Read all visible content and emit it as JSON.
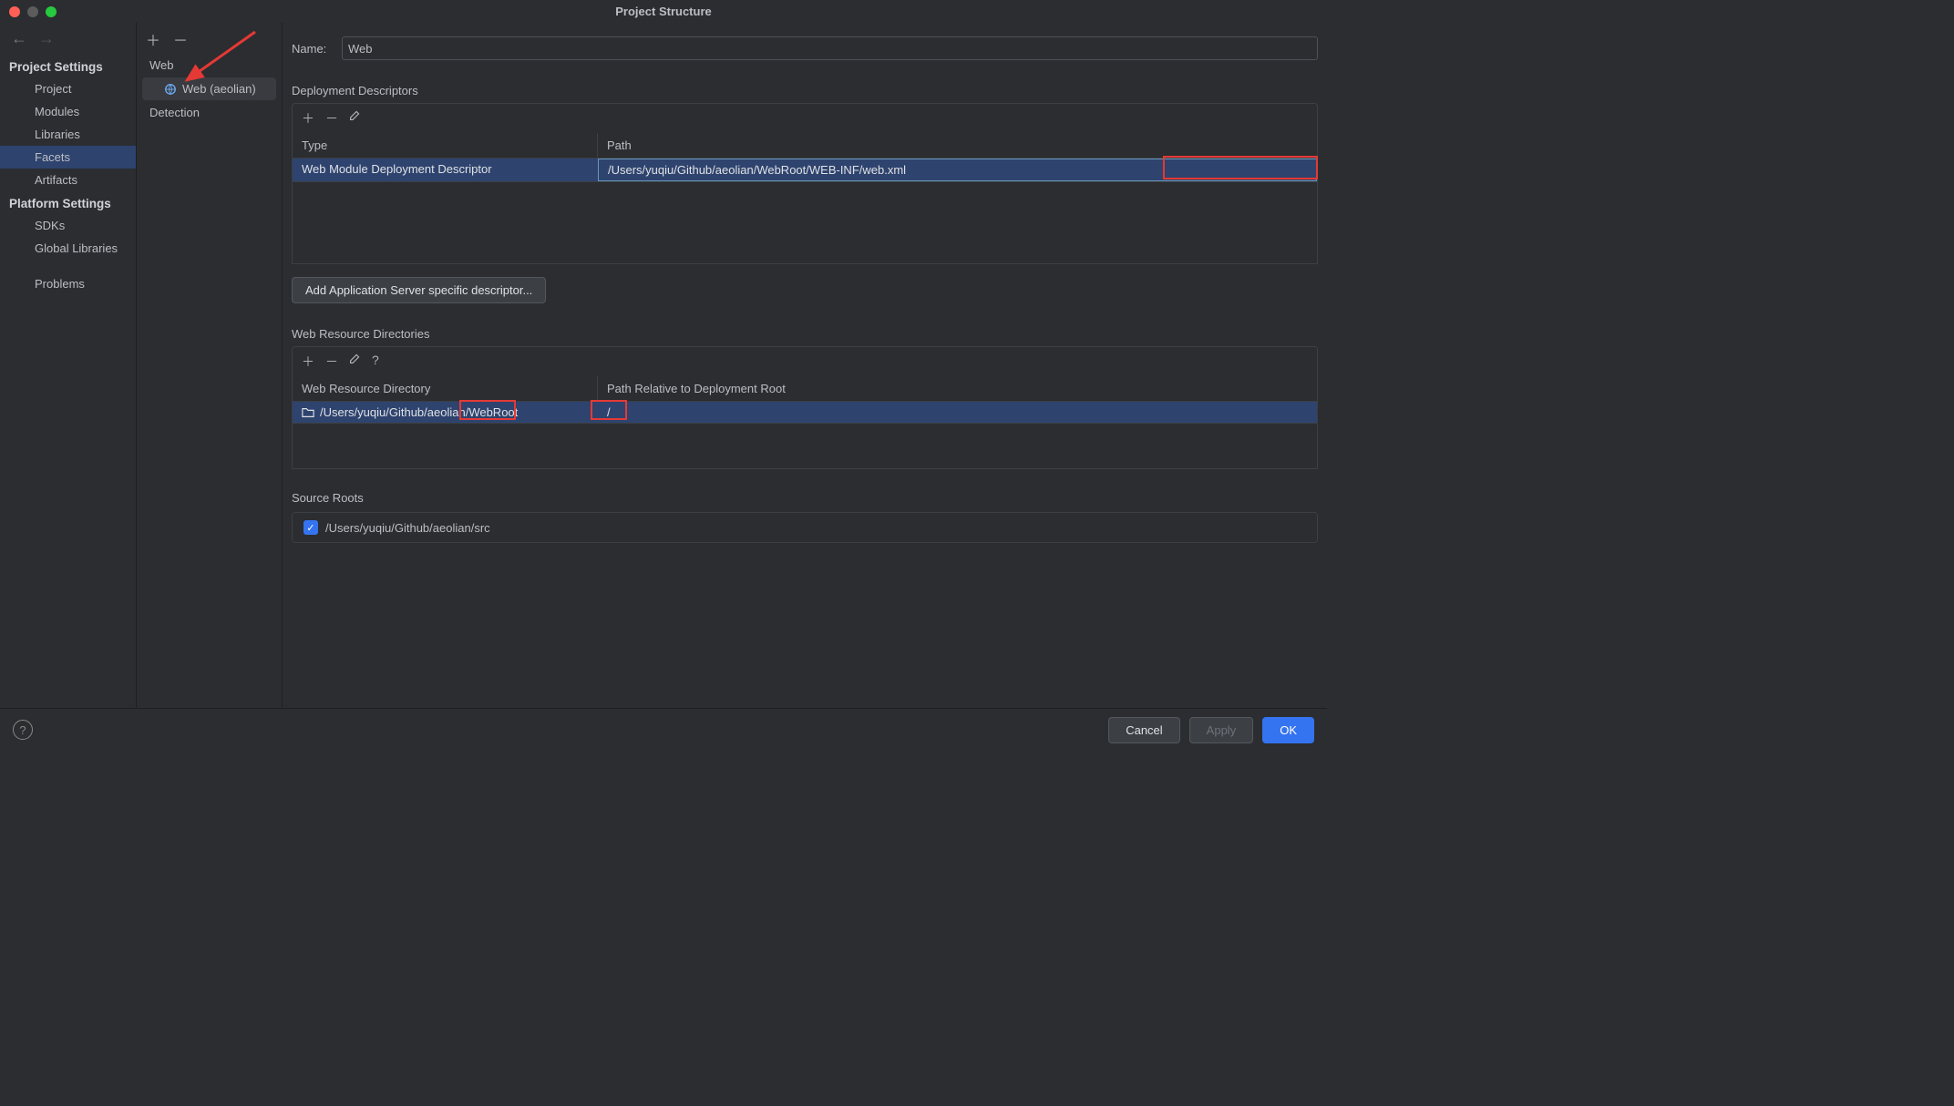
{
  "window": {
    "title": "Project Structure"
  },
  "sidebar": {
    "groups": [
      {
        "title": "Project Settings",
        "items": [
          {
            "label": "Project"
          },
          {
            "label": "Modules"
          },
          {
            "label": "Libraries"
          },
          {
            "label": "Facets",
            "selected": true
          },
          {
            "label": "Artifacts"
          }
        ]
      },
      {
        "title": "Platform Settings",
        "items": [
          {
            "label": "SDKs"
          },
          {
            "label": "Global Libraries"
          }
        ]
      }
    ],
    "problems": "Problems"
  },
  "tree": {
    "root": "Web",
    "child": "Web (aeolian)",
    "detection": "Detection"
  },
  "form": {
    "name_label": "Name:",
    "name_value": "Web"
  },
  "deployment_descriptors": {
    "title": "Deployment Descriptors",
    "columns": {
      "type": "Type",
      "path": "Path"
    },
    "row": {
      "type": "Web Module Deployment Descriptor",
      "path": "/Users/yuqiu/Github/aeolian/WebRoot/WEB-INF/web.xml"
    },
    "button": "Add Application Server specific descriptor..."
  },
  "web_resource_dirs": {
    "title": "Web Resource Directories",
    "columns": {
      "dir": "Web Resource Directory",
      "path": "Path Relative to Deployment Root"
    },
    "row": {
      "dir": "/Users/yuqiu/Github/aeolian/WebRoot",
      "path": "/"
    }
  },
  "source_roots": {
    "title": "Source Roots",
    "item": "/Users/yuqiu/Github/aeolian/src",
    "checked": true
  },
  "footer": {
    "cancel": "Cancel",
    "apply": "Apply",
    "ok": "OK"
  },
  "annotation": {
    "arrow_color": "#e53935",
    "red_box_color": "#e53935"
  }
}
